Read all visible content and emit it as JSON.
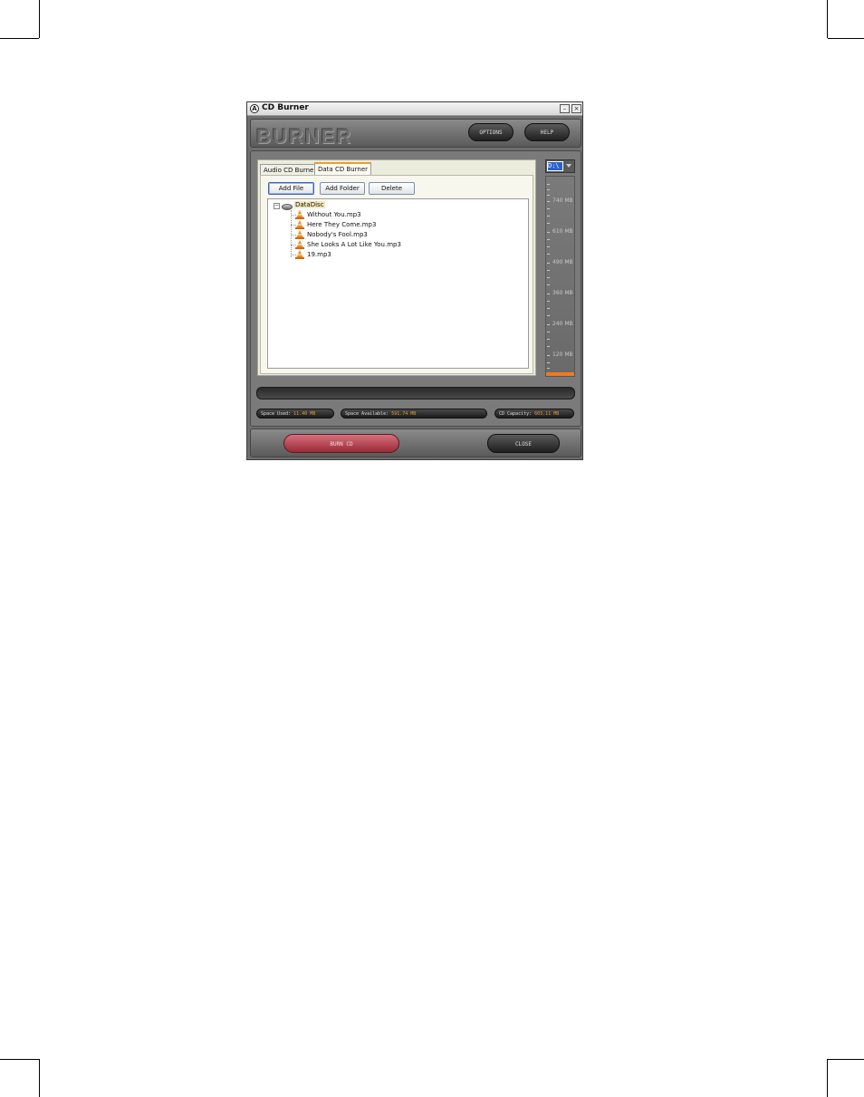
{
  "window": {
    "title": "CD Burner",
    "minimize": "–",
    "close": "×",
    "app_icon": "A"
  },
  "header": {
    "logo": "BURNER",
    "options_label": "OPTIONS",
    "help_label": "HELP"
  },
  "tabs": [
    {
      "label": "Audio CD Burner",
      "active": false
    },
    {
      "label": "Data CD Burner",
      "active": true
    }
  ],
  "toolbar": {
    "add_file": "Add File",
    "add_folder": "Add Folder",
    "delete": "Delete"
  },
  "tree": {
    "root": "DataDisc",
    "files": [
      "Without You.mp3",
      "Here They Come.mp3",
      "Nobody's Fool.mp3",
      "She Looks A Lot Like You.mp3",
      "19.mp3"
    ]
  },
  "drive": {
    "value": "D:\\"
  },
  "meter": {
    "ticks": [
      "740 MB",
      "610 MB",
      "490 MB",
      "360 MB",
      "240 MB",
      "120 MB"
    ],
    "fill_color": "#f07a1f"
  },
  "status": {
    "space_used_label": "Space Used:",
    "space_used_value": "11.40 MB",
    "space_available_label": "Space Available:",
    "space_available_value": "591.74 MB",
    "capacity_label": "CD Capacity:",
    "capacity_value": "603.11 MB"
  },
  "footer": {
    "burn_label": "BURN CD",
    "close_label": "CLOSE"
  }
}
